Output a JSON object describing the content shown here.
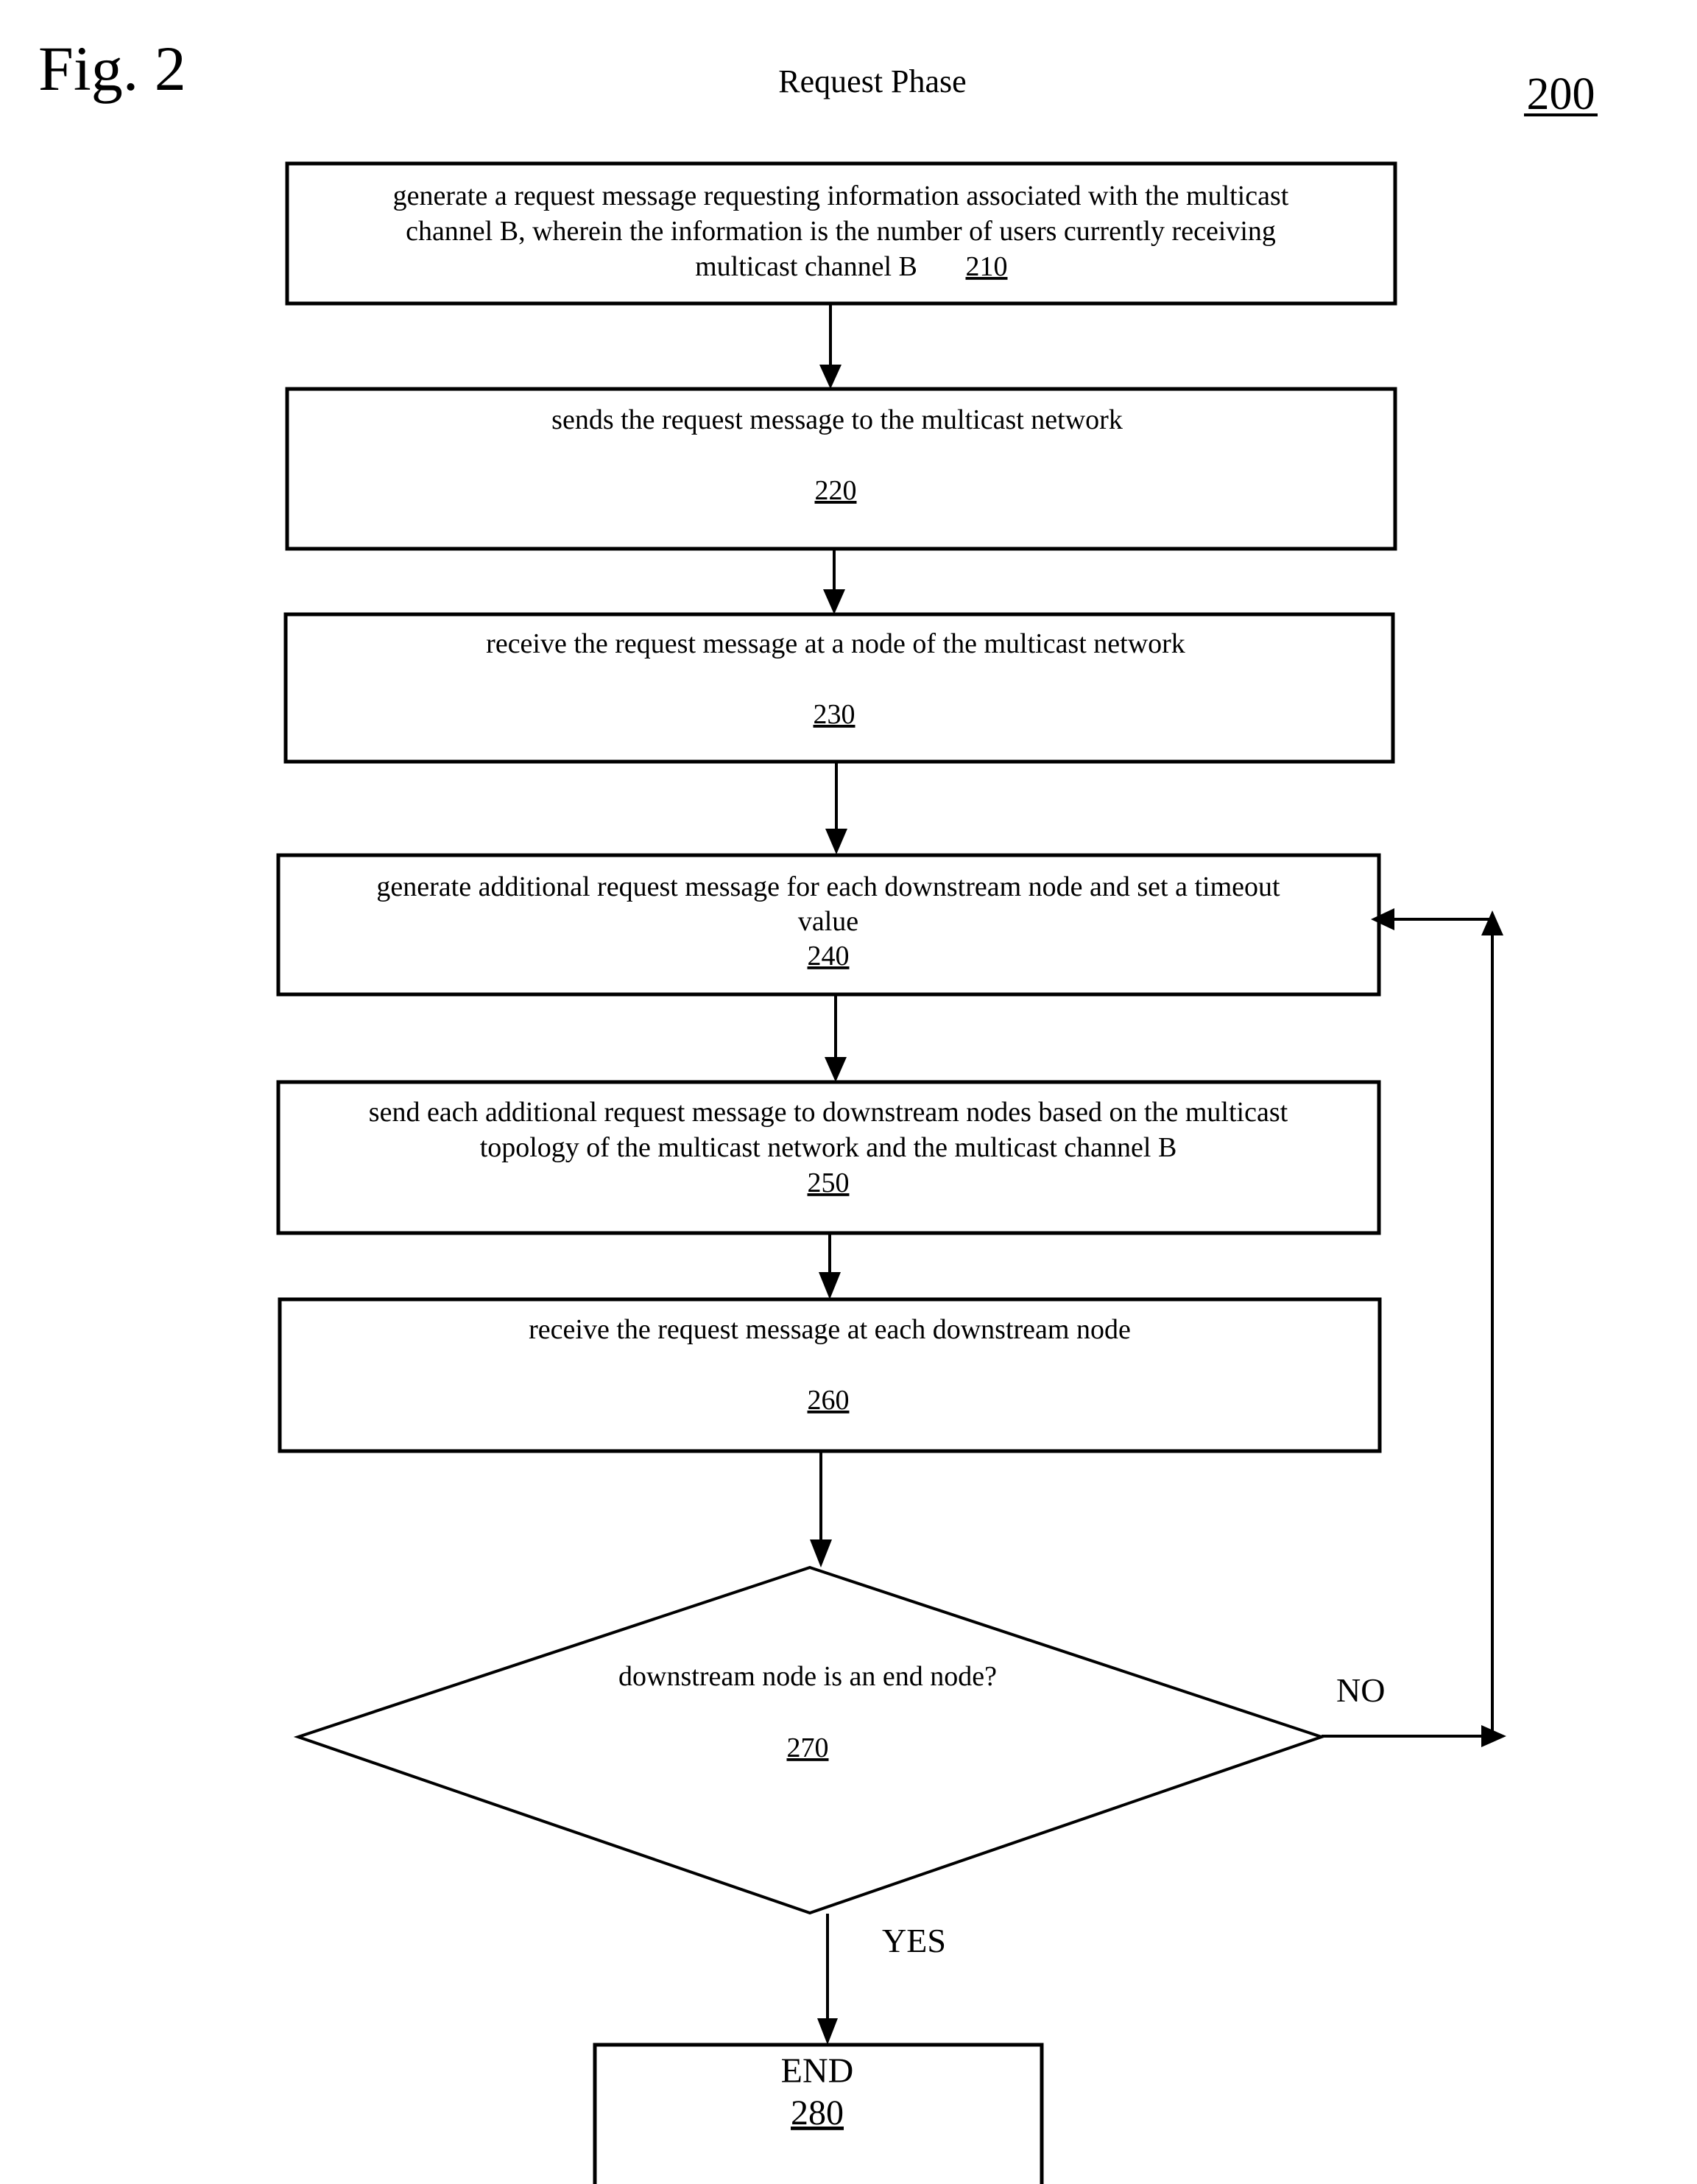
{
  "header": {
    "figure_label": "Fig. 2",
    "title": "Request Phase",
    "figure_ref": "200"
  },
  "steps": [
    {
      "id": "210",
      "lines": [
        "generate a request message requesting information associated with the multicast",
        "channel B, wherein the information is the number of users currently  receiving",
        "multicast channel B"
      ],
      "ref": "210"
    },
    {
      "id": "220",
      "lines": [
        "sends the request message to the multicast network"
      ],
      "ref": "220"
    },
    {
      "id": "230",
      "lines": [
        "receive the request message at a node of the multicast network"
      ],
      "ref": "230"
    },
    {
      "id": "240",
      "lines": [
        "generate additional request message for each downstream node and set a timeout",
        "value"
      ],
      "ref": "240"
    },
    {
      "id": "250",
      "lines": [
        "send each additional request message to downstream nodes based on the multicast",
        "topology of the multicast network and the multicast channel B"
      ],
      "ref": "250"
    },
    {
      "id": "260",
      "lines": [
        "receive the request message at each downstream node"
      ],
      "ref": "260"
    }
  ],
  "decision": {
    "question": "downstream node is an end node?",
    "ref": "270",
    "no_label": "NO",
    "yes_label": "YES"
  },
  "end": {
    "label": "END",
    "ref": "280"
  }
}
